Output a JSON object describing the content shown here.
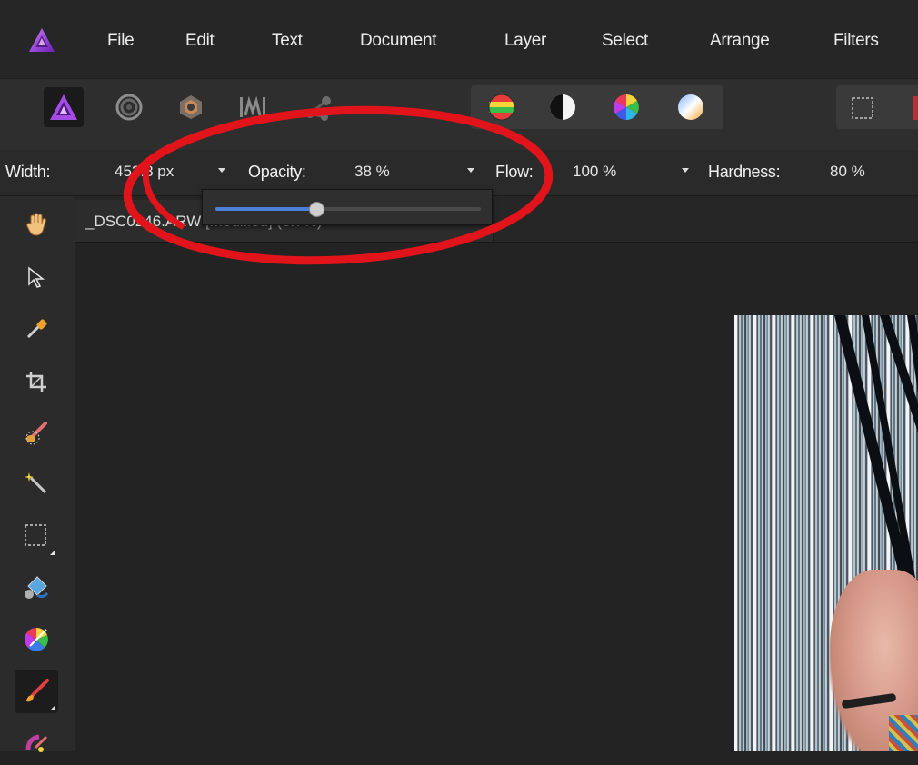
{
  "menu": {
    "items": [
      "File",
      "Edit",
      "Text",
      "Document",
      "Layer",
      "Select",
      "Arrange",
      "Filters"
    ]
  },
  "toolbar": {
    "personas": [
      "photo-persona",
      "liquify-persona",
      "develop-persona",
      "tone-mapping-persona",
      "export-persona"
    ],
    "adjustments": [
      "hsl-adjustment",
      "black-white-adjustment",
      "color-wheel-adjustment",
      "white-balance-adjustment"
    ]
  },
  "context": {
    "width_label": "Width:",
    "width_value": "452.8 px",
    "opacity_label": "Opacity:",
    "opacity_value": "38 %",
    "flow_label": "Flow:",
    "flow_value": "100 %",
    "hardness_label": "Hardness:",
    "hardness_value": "80 %"
  },
  "opacity_slider": {
    "value_fraction": 0.38
  },
  "document": {
    "tab_name": "_DSC0246.ARW",
    "tab_status": "[Modified] (8.7%)"
  },
  "tools": [
    "view-tool",
    "move-tool",
    "color-picker-tool",
    "crop-tool",
    "selection-brush-tool",
    "flood-select-tool",
    "marquee-tool",
    "flood-fill-tool",
    "gradient-tool",
    "paint-brush-tool",
    "dodge-brush-tool"
  ],
  "colors": {
    "accent_purple": "#9b3fd6",
    "slider_blue": "#4b7fd8",
    "annotation_red": "#e0141a"
  }
}
